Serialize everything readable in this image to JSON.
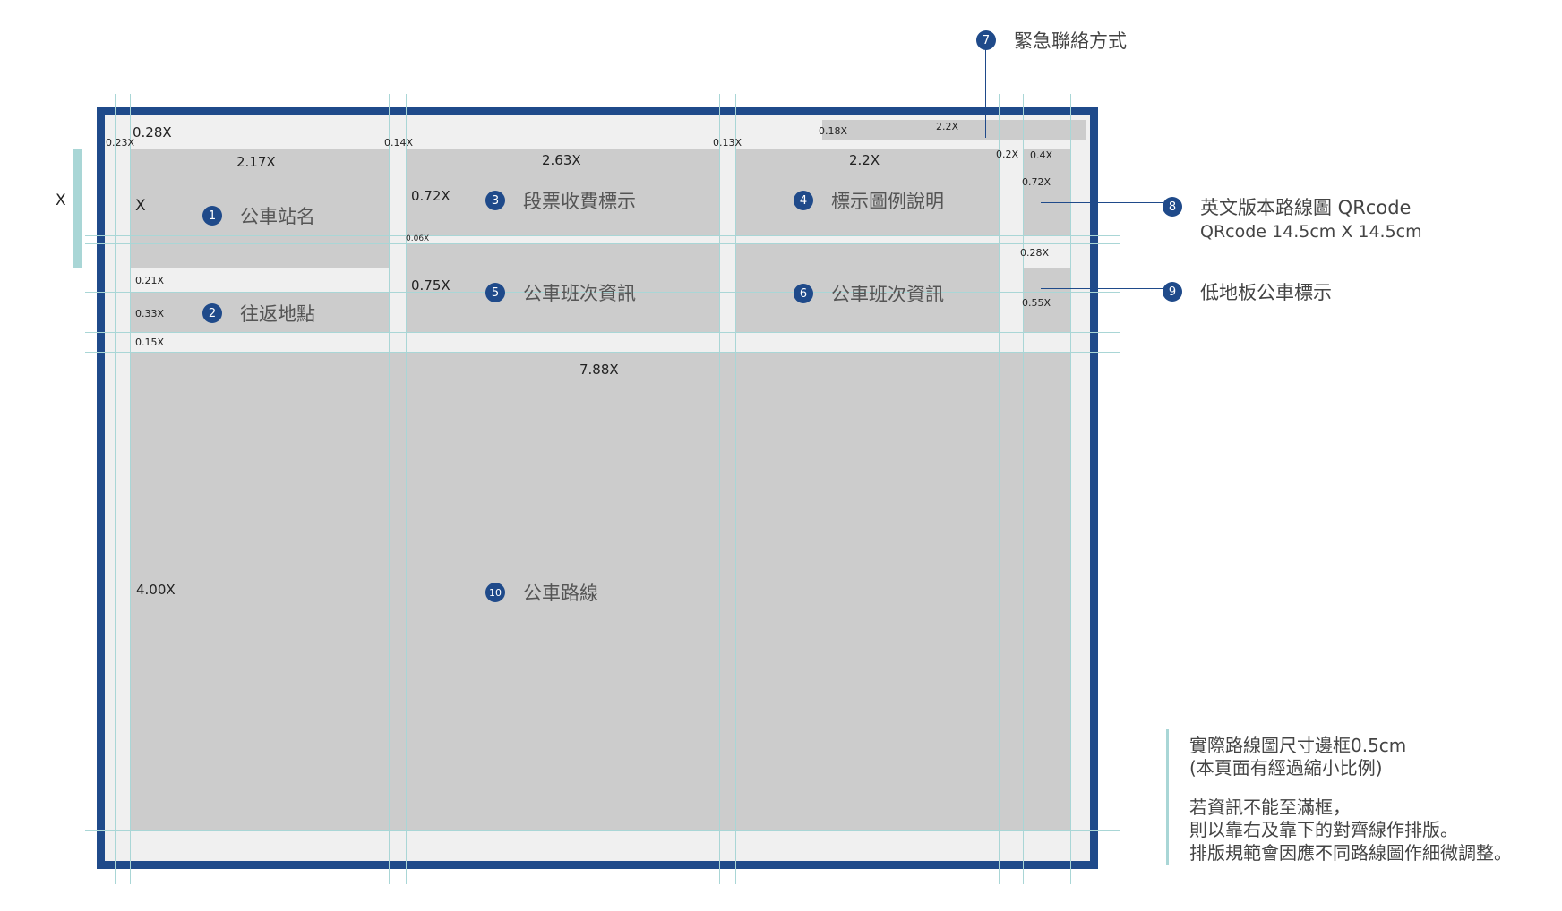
{
  "dimensions": {
    "x_marker": "X",
    "top_margin": "0.28X",
    "left_margin": "0.23X",
    "col1_width": "2.17X",
    "col1_height": "X",
    "gap_14": "0.14X",
    "col2_width": "2.63X",
    "gap_13": "0.13X",
    "col3_width": "2.2X",
    "contact_height": "0.18X",
    "contact_width": "2.2X",
    "right_gap": "0.2X",
    "qr_width": "0.4X",
    "qr_height": "0.72X",
    "fare_height": "0.72X",
    "gap_06": "0.06X",
    "schedule_height": "0.75X",
    "gap_28": "0.28X",
    "lowfloor_height": "0.55X",
    "gap_21": "0.21X",
    "roundtrip_height": "0.33X",
    "gap_15": "0.15X",
    "route_width": "7.88X",
    "route_height": "4.00X"
  },
  "sections": {
    "s1": {
      "num": "1",
      "label": "公車站名"
    },
    "s2": {
      "num": "2",
      "label": "往返地點"
    },
    "s3": {
      "num": "3",
      "label": "段票收費標示"
    },
    "s4": {
      "num": "4",
      "label": "標示圖例說明"
    },
    "s5": {
      "num": "5",
      "label": "公車班次資訊"
    },
    "s6": {
      "num": "6",
      "label": "公車班次資訊"
    },
    "s10": {
      "num": "10",
      "label": "公車路線"
    }
  },
  "callouts": {
    "c7": {
      "num": "7",
      "label": "緊急聯絡方式"
    },
    "c8": {
      "num": "8",
      "label": "英文版本路線圖 QRcode",
      "sub": "QRcode  14.5cm X 14.5cm"
    },
    "c9": {
      "num": "9",
      "label": "低地板公車標示"
    }
  },
  "notes": {
    "line1": "實際路線圖尺寸邊框0.5cm",
    "line2": "(本頁面有經過縮小比例)",
    "line3": "若資訊不能至滿框，",
    "line4": "則以靠右及靠下的對齊線作排版。",
    "line5": "排版規範會因應不同路線圖作細微調整。"
  },
  "colors": {
    "frame": "#1f4a8a",
    "block": "#cccccc",
    "background": "#f0f0f0",
    "guide": "#a9d6d6"
  }
}
